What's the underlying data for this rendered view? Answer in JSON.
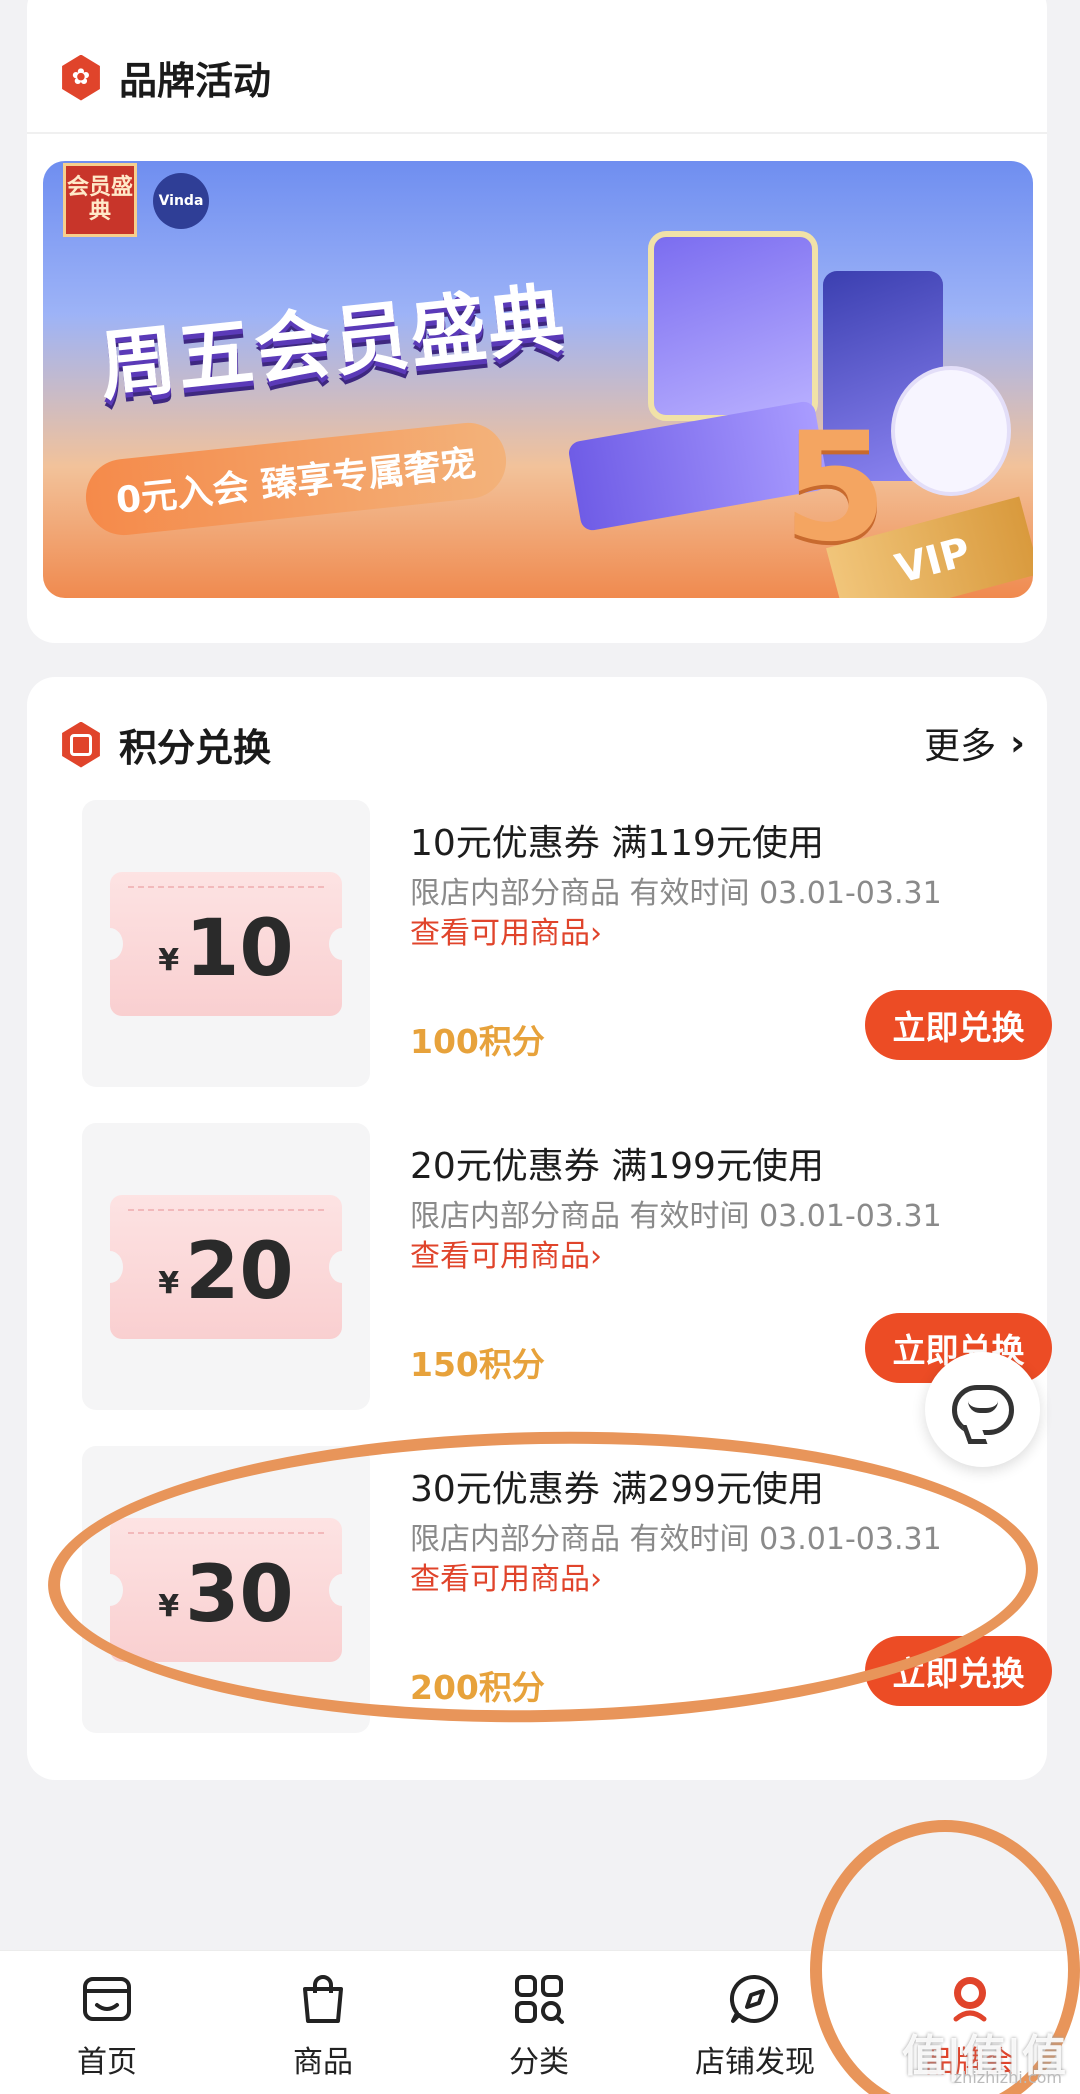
{
  "brand_section": {
    "title": "品牌活动",
    "banner": {
      "badge_left": "会员盛典",
      "badge_right": "Vinda",
      "headline": "周五会员盛典",
      "subline": "0元入会 臻享专属奢宠",
      "big_number": "5",
      "vip": "VIP"
    }
  },
  "points_section": {
    "title": "积分兑换",
    "more_label": "更多",
    "coupons": [
      {
        "symbol": "¥",
        "amount": "10",
        "title": "10元优惠券 满119元使用",
        "desc": "限店内部分商品 有效时间 03.01-03.31",
        "view_label": "查看可用商品",
        "points": "100积分",
        "button": "立即兑换"
      },
      {
        "symbol": "¥",
        "amount": "20",
        "title": "20元优惠券 满199元使用",
        "desc": "限店内部分商品 有效时间 03.01-03.31",
        "view_label": "查看可用商品",
        "points": "150积分",
        "button": "立即兑换"
      },
      {
        "symbol": "¥",
        "amount": "30",
        "title": "30元优惠券 满299元使用",
        "desc": "限店内部分商品 有效时间 03.01-03.31",
        "view_label": "查看可用商品",
        "points": "200积分",
        "button": "立即兑换"
      }
    ]
  },
  "bottom_nav": [
    {
      "label": "首页",
      "icon": "store-icon"
    },
    {
      "label": "商品",
      "icon": "bag-icon"
    },
    {
      "label": "分类",
      "icon": "grid-icon"
    },
    {
      "label": "店铺发现",
      "icon": "compass-icon"
    },
    {
      "label": "品牌会",
      "icon": "member-icon"
    }
  ],
  "watermark": {
    "main": "值|值|值",
    "sub": "zhizhizhi.com"
  },
  "colors": {
    "accent": "#e0442b",
    "button": "#ec4c25",
    "points": "#e7a23b",
    "annotation": "#e8955a"
  }
}
